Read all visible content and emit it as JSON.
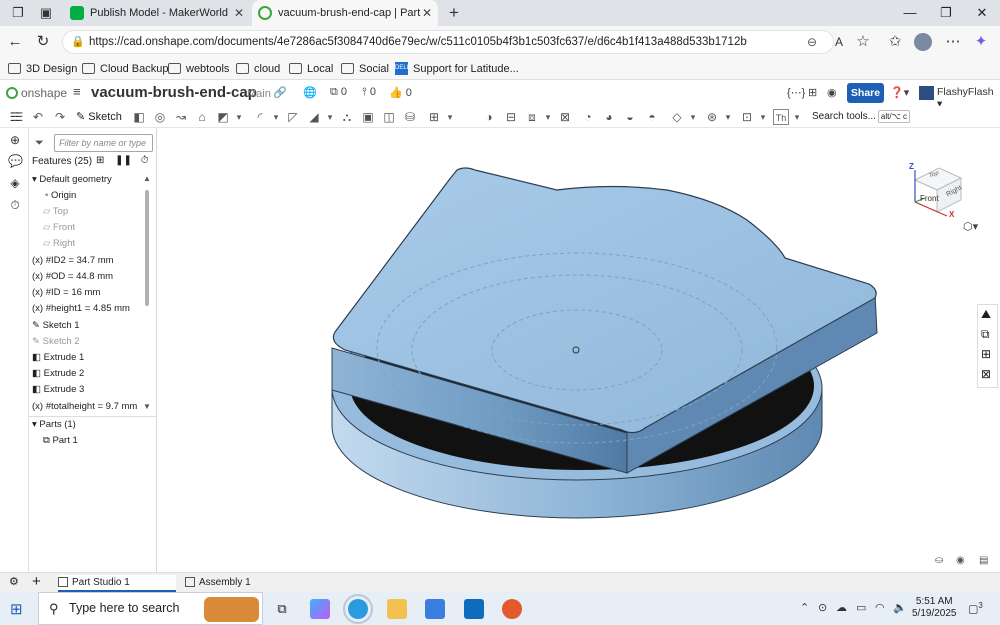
{
  "browser": {
    "tabs": [
      {
        "title": "Publish Model - MakerWorld",
        "color": "#00ae42"
      },
      {
        "title": "vacuum-brush-end-cap | Part Stu",
        "color": "#3ea43e"
      }
    ],
    "url": "https://cad.onshape.com/documents/4e7286ac5f3084740d6e79ec/w/c511c0105b4f3b1c503fc637/e/d6c4b1f413a488d533b1712b",
    "bookmarks": [
      "3D Design",
      "Cloud Backup",
      "webtools",
      "cloud",
      "Local",
      "Social",
      "Support for Latitude..."
    ],
    "dell_logo": "DELL"
  },
  "onshape": {
    "logo": "onshape",
    "doc_name": "vacuum-brush-end-cap",
    "branch": "Main",
    "versions_count": "0",
    "branches_count": "0",
    "likes_count": "0",
    "share_label": "Share",
    "user": "FlashyFlash"
  },
  "toolbar": {
    "sketch_label": "Sketch",
    "search_tools": "Search tools...",
    "shortcut": "alt/⌥ c",
    "th_label": "Th"
  },
  "features": {
    "filter_placeholder": "Filter by name or type",
    "header": "Features (25)",
    "default_geometry": "Default geometry",
    "items": [
      {
        "label": "Origin",
        "dim": false
      },
      {
        "label": "Top",
        "dim": true
      },
      {
        "label": "Front",
        "dim": true
      },
      {
        "label": "Right",
        "dim": true
      },
      {
        "label": "#ID2 = 34.7 mm",
        "dim": false
      },
      {
        "label": "#OD = 44.8 mm",
        "dim": false
      },
      {
        "label": "#ID = 16 mm",
        "dim": false
      },
      {
        "label": "#height1 = 4.85 mm",
        "dim": false
      },
      {
        "label": "Sketch 1",
        "dim": false
      },
      {
        "label": "Sketch 2",
        "dim": true
      },
      {
        "label": "Extrude 1",
        "dim": false
      },
      {
        "label": "Extrude 2",
        "dim": false
      },
      {
        "label": "Extrude 3",
        "dim": false
      },
      {
        "label": "#totalheight = 9.7 mm",
        "dim": false
      }
    ],
    "parts_header": "Parts (1)",
    "parts": [
      "Part 1"
    ]
  },
  "viewcube": {
    "top": "Top",
    "front": "Front",
    "right": "Right",
    "axis_z": "Z",
    "axis_x": "X"
  },
  "bottom_tabs": [
    "Part Studio 1",
    "Assembly 1"
  ],
  "taskbar": {
    "search_placeholder": "Type here to search",
    "time": "5:51 AM",
    "date": "5/19/2025",
    "notif_count": "3"
  },
  "colors": {
    "part_face": "#9fc3e3",
    "part_side": "#6d98c0",
    "share": "#1d5fb4"
  }
}
